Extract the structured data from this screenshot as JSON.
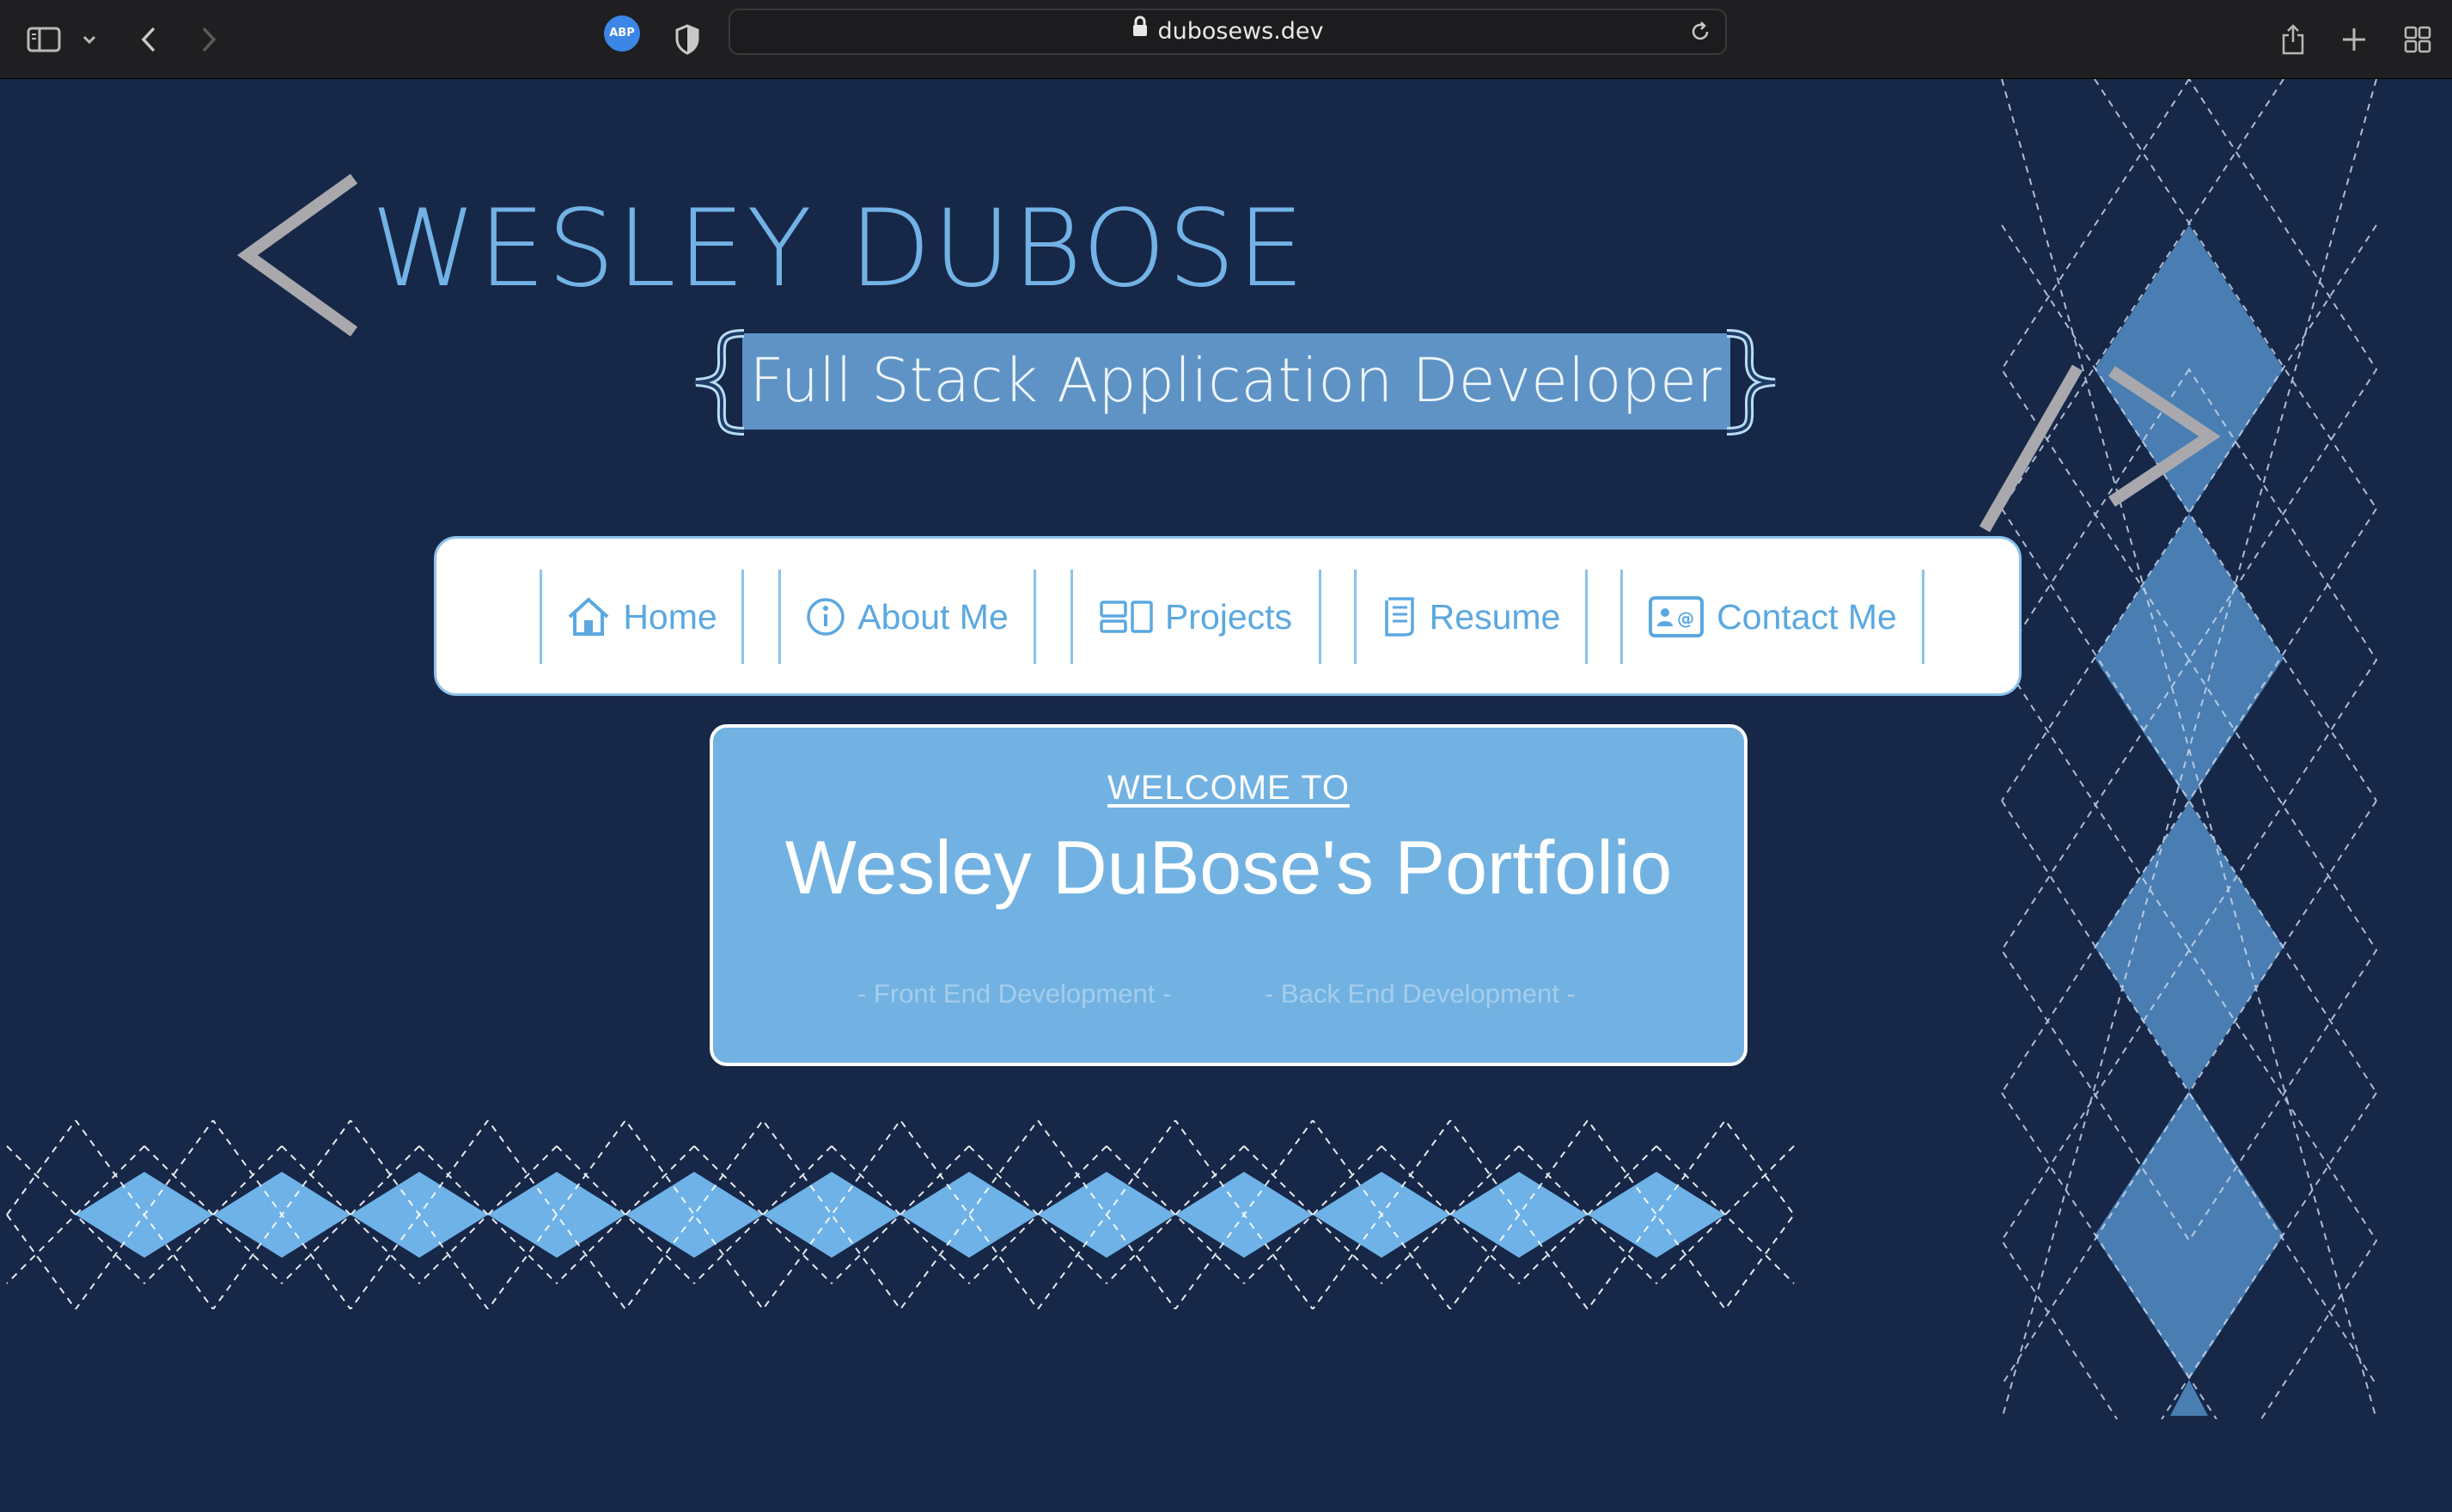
{
  "browser": {
    "url": "dubosews.dev",
    "adblock_label": "ABP",
    "icons": [
      "sidebar-icon",
      "chevron-down-icon",
      "back-icon",
      "forward-icon",
      "adblock-icon",
      "shield-icon",
      "lock-icon",
      "reload-icon",
      "share-icon",
      "new-tab-icon",
      "tab-overview-icon"
    ]
  },
  "header": {
    "open_tag": "<",
    "name": "WESLEY DUBOSE",
    "subtitle": "Full Stack Application Developer",
    "close_tag": "/>"
  },
  "nav": {
    "items": [
      {
        "label": "Home",
        "icon": "home-icon"
      },
      {
        "label": "About Me",
        "icon": "info-icon"
      },
      {
        "label": "Projects",
        "icon": "projects-icon"
      },
      {
        "label": "Resume",
        "icon": "document-icon"
      },
      {
        "label": "Contact Me",
        "icon": "contact-card-icon"
      }
    ]
  },
  "welcome": {
    "kicker": "WELCOME TO",
    "title": "Wesley DuBose's Portfolio",
    "taglines": [
      "- Front End Development -",
      "- Back End Development -"
    ]
  },
  "colors": {
    "background": "#172747",
    "accent": "#72b2e6",
    "argyle_right": "#4a7eb3",
    "argyle_bottom": "#6fb2e8",
    "nav_bg": "#ffffff"
  }
}
